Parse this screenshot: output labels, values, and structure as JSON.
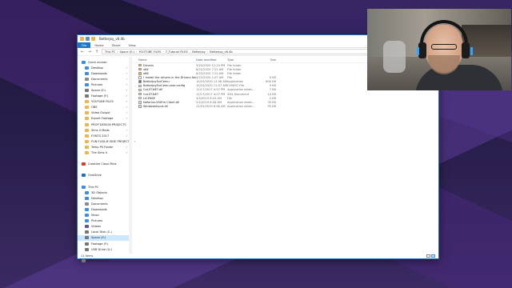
{
  "window": {
    "title": "Betterjoy_v6.4b",
    "controls": [
      "—",
      "☐",
      "✕"
    ]
  },
  "ribbon": {
    "tabs": [
      "File",
      "Home",
      "Share",
      "View"
    ],
    "help": "?"
  },
  "address": {
    "crumbs": [
      "This PC",
      "Space (E:)",
      "YOUTUBE FILES",
      "7_Tutorial FILES",
      "Betterjoy",
      "Betterjoy_v6.4b"
    ],
    "search_placeholder": "Search Betterjoy_v6.4b"
  },
  "nav": {
    "items": [
      {
        "label": "Quick access",
        "icon": "star-icon",
        "color": "#3a8ee6",
        "indent": false,
        "pinned": false
      },
      {
        "label": "Desktop",
        "icon": "desktop-icon",
        "color": "#3a8ee6",
        "indent": true,
        "pinned": true
      },
      {
        "label": "Downloads",
        "icon": "download-icon",
        "color": "#3a8ee6",
        "indent": true,
        "pinned": true
      },
      {
        "label": "Documents",
        "icon": "document-icon",
        "color": "#8a8a8a",
        "indent": true,
        "pinned": true
      },
      {
        "label": "Pictures",
        "icon": "picture-icon",
        "color": "#3a8ee6",
        "indent": true,
        "pinned": true
      },
      {
        "label": "Space (E:)",
        "icon": "drive-icon",
        "color": "#777777",
        "indent": true,
        "pinned": true
      },
      {
        "label": "Footage (F:)",
        "icon": "drive-icon",
        "color": "#777777",
        "indent": true,
        "pinned": true
      },
      {
        "label": "YOUTUBE FILES",
        "icon": "folder-icon",
        "color": "#e8b84a",
        "indent": true,
        "pinned": true
      },
      {
        "label": "OBS",
        "icon": "folder-icon",
        "color": "#e8b84a",
        "indent": true,
        "pinned": true
      },
      {
        "label": "Video Output",
        "icon": "folder-icon",
        "color": "#e8b84a",
        "indent": true,
        "pinned": true
      },
      {
        "label": "Export Footage",
        "icon": "folder-icon",
        "color": "#e8b84a",
        "indent": true,
        "pinned": true
      },
      {
        "label": "PROP DESIGN PROJECTS",
        "icon": "folder-icon",
        "color": "#e8b84a",
        "indent": true,
        "pinned": true
      },
      {
        "label": "Sims 4 Mods",
        "icon": "folder-icon",
        "color": "#e8b84a",
        "indent": true,
        "pinned": true
      },
      {
        "label": "FONTS 2017",
        "icon": "folder-icon",
        "color": "#e8b84a",
        "indent": true,
        "pinned": true
      },
      {
        "label": "FUN FLEX-IE SIDE PROJECTS",
        "icon": "folder-icon",
        "color": "#e8b84a",
        "indent": true,
        "pinned": true
      },
      {
        "label": "Temp PS Folder",
        "icon": "folder-icon",
        "color": "#e8b84a",
        "indent": true,
        "pinned": true
      },
      {
        "label": "The Sims 4",
        "icon": "folder-icon",
        "color": "#e8b84a",
        "indent": true,
        "pinned": true
      },
      {
        "label": "",
        "icon": "",
        "color": "",
        "indent": false,
        "pinned": false
      },
      {
        "label": "Creative Cloud Files",
        "icon": "cloud-icon",
        "color": "#da3b2b",
        "indent": false,
        "pinned": false
      },
      {
        "label": "",
        "icon": "",
        "color": "",
        "indent": false,
        "pinned": false
      },
      {
        "label": "OneDrive",
        "icon": "cloud-icon",
        "color": "#1e70c8",
        "indent": false,
        "pinned": false
      },
      {
        "label": "",
        "icon": "",
        "color": "",
        "indent": false,
        "pinned": false
      },
      {
        "label": "This PC",
        "icon": "computer-icon",
        "color": "#3a8ee6",
        "indent": false,
        "pinned": false
      },
      {
        "label": "3D Objects",
        "icon": "cube-icon",
        "color": "#3a8ee6",
        "indent": true,
        "pinned": false
      },
      {
        "label": "Desktop",
        "icon": "desktop-icon",
        "color": "#3a8ee6",
        "indent": true,
        "pinned": false
      },
      {
        "label": "Documents",
        "icon": "document-icon",
        "color": "#8a8a8a",
        "indent": true,
        "pinned": false
      },
      {
        "label": "Downloads",
        "icon": "download-icon",
        "color": "#3a8ee6",
        "indent": true,
        "pinned": false
      },
      {
        "label": "Music",
        "icon": "music-icon",
        "color": "#3a8ee6",
        "indent": true,
        "pinned": false
      },
      {
        "label": "Pictures",
        "icon": "picture-icon",
        "color": "#3a8ee6",
        "indent": true,
        "pinned": false
      },
      {
        "label": "Videos",
        "icon": "video-icon",
        "color": "#5a5a9a",
        "indent": true,
        "pinned": false
      },
      {
        "label": "Local Disk (C:)",
        "icon": "drive-icon",
        "color": "#777777",
        "indent": true,
        "pinned": false
      },
      {
        "label": "Space (E:)",
        "icon": "drive-icon",
        "color": "#777777",
        "indent": true,
        "pinned": false,
        "selected": true
      },
      {
        "label": "Footage (F:)",
        "icon": "drive-icon",
        "color": "#777777",
        "indent": true,
        "pinned": false
      },
      {
        "label": "USB Drive (G:)",
        "icon": "usb-drive-icon",
        "color": "#777777",
        "indent": true,
        "pinned": false
      },
      {
        "label": "",
        "icon": "",
        "color": "",
        "indent": false,
        "pinned": false
      },
      {
        "label": "USB Drive (G:)",
        "icon": "usb-drive-icon",
        "color": "#777777",
        "indent": false,
        "pinned": false
      }
    ]
  },
  "columns": {
    "name": "Name",
    "date": "Date modified",
    "type": "Type",
    "size": "Size"
  },
  "files": [
    {
      "name": "Drivers",
      "date": "3/20/2020 12:24 PM",
      "type": "File folder",
      "size": "",
      "icon": "folder-icon",
      "color": "#e8b84a"
    },
    {
      "name": "x64",
      "date": "8/22/2020 7:22 AM",
      "type": "File folder",
      "size": "",
      "icon": "folder-icon",
      "color": "#e8b84a"
    },
    {
      "name": "x86",
      "date": "8/22/2020 7:22 AM",
      "type": "File folder",
      "size": "",
      "icon": "folder-icon",
      "color": "#e8b84a"
    },
    {
      "name": "! Install the drivers in the Drivers folder",
      "date": "4/22/2020 1:07 AM",
      "type": "File",
      "size": "0 KB",
      "icon": "file-icon",
      "color": "#ffffff"
    },
    {
      "name": "BetterJoyForCemu",
      "date": "10/24/2020 11:56 AM",
      "type": "Application",
      "size": "800 KB",
      "icon": "app-icon",
      "color": "#5a6b85"
    },
    {
      "name": "BetterJoyForCemu.exe.config",
      "date": "10/24/2020 11:57 AM",
      "type": "CONFIG File",
      "size": "9 KB",
      "icon": "config-icon",
      "color": "#e0e0e0"
    },
    {
      "name": "CoLST.NET.dll",
      "date": "12/17/2017 4:07 PM",
      "type": "Application exten...",
      "size": "7 KB",
      "icon": "dll-icon",
      "color": "#e0e0e0"
    },
    {
      "name": "CoLST.NET",
      "date": "12/17/2017 4:07 PM",
      "type": "XML Document",
      "size": "14 KB",
      "icon": "xml-icon",
      "color": "#f1d37a"
    },
    {
      "name": "LICENSE",
      "date": "3/2/2019 8:25 AM",
      "type": "File",
      "size": "2 KB",
      "icon": "file-icon",
      "color": "#ffffff"
    },
    {
      "name": "Nefarius.ViGEm.Client.dll",
      "date": "2/2/2019 8:08 AM",
      "type": "Application exten...",
      "size": "35 KB",
      "icon": "dll-icon",
      "color": "#e0e0e0"
    },
    {
      "name": "WindowsInput.dll",
      "date": "12/31/2019 6:46 AM",
      "type": "Application exten...",
      "size": "55 KB",
      "icon": "dll-icon",
      "color": "#e0e0e0"
    }
  ],
  "status": {
    "items": "11 items"
  }
}
